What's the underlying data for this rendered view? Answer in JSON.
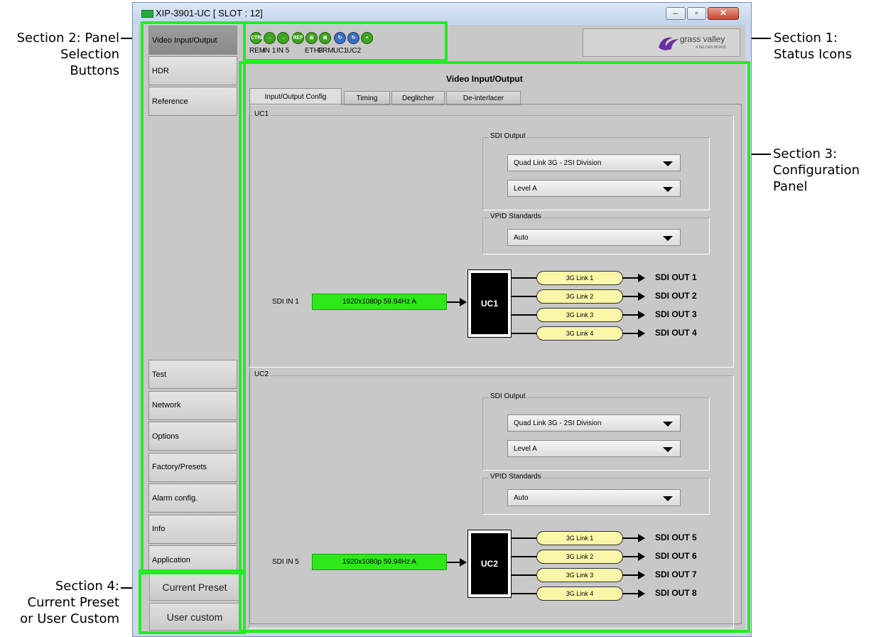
{
  "callouts": {
    "section1": "Section 1:\nStatus Icons",
    "section2": "Section 2: Panel\nSelection\nButtons",
    "section3": "Section 3:\nConfiguration\nPanel",
    "section4": "Section 4:\nCurrent Preset\nor User Custom"
  },
  "window": {
    "title": "XIP-3901-UC [ SLOT : 12]",
    "minimize_icon": "minimize-icon",
    "maximize_icon": "maximize-icon",
    "close_icon": "close-icon"
  },
  "sidebar": {
    "top_items": [
      {
        "label": "Video Input/Output",
        "active": true
      },
      {
        "label": "HDR"
      },
      {
        "label": "Reference"
      }
    ],
    "bottom_items": [
      {
        "label": "Test"
      },
      {
        "label": "Network"
      },
      {
        "label": "Options"
      },
      {
        "label": "Factory/Presets"
      },
      {
        "label": "Alarm config."
      },
      {
        "label": "Info"
      },
      {
        "label": "Application"
      }
    ]
  },
  "preset": {
    "current_preset_label": "Current Preset",
    "user_custom_label": "User custom"
  },
  "status_icons": [
    {
      "icon": "ctrl-icon",
      "glyph": "CTRL",
      "label": "REM"
    },
    {
      "icon": "arrow-right-icon",
      "glyph": "→",
      "label": "IN 1"
    },
    {
      "icon": "arrow-right-icon",
      "glyph": "→",
      "label": "IN 5"
    },
    {
      "icon": "ref-icon",
      "glyph": "REF",
      "label": ""
    },
    {
      "icon": "network-icon",
      "glyph": "⊞",
      "label": "ETH3"
    },
    {
      "icon": "network-icon",
      "glyph": "⊞",
      "label": "FRM"
    },
    {
      "icon": "uc-icon",
      "glyph": "↻",
      "label": "UC1"
    },
    {
      "icon": "uc-icon",
      "glyph": "↻",
      "label": "UC2"
    },
    {
      "icon": "plus-icon",
      "glyph": "+",
      "label": ""
    }
  ],
  "logo": {
    "text": "grass valley",
    "subtext": "A BELDEN BRAND"
  },
  "panel": {
    "title": "Video Input/Output",
    "tabs": [
      {
        "label": "Input/Output Config",
        "active": true
      },
      {
        "label": "Timing"
      },
      {
        "label": "Deglitcher"
      },
      {
        "label": "De-interlacer"
      }
    ],
    "uc1": {
      "group_label": "UC1",
      "sdi_output_label": "SDI Output",
      "sdi_output_value": "Quad Link 3G - 2SI Division",
      "level_value": "Level A",
      "vpid_label": "VPID Standards",
      "vpid_value": "Auto",
      "input_label": "SDI IN 1",
      "input_format": "1920x1080p 59.94Hz A",
      "block_label": "UC1",
      "links": [
        "3G Link 1",
        "3G Link 2",
        "3G Link 3",
        "3G Link 4"
      ],
      "outputs": [
        "SDI OUT 1",
        "SDI OUT 2",
        "SDI OUT 3",
        "SDI OUT 4"
      ]
    },
    "uc2": {
      "group_label": "UC2",
      "sdi_output_label": "SDI Output",
      "sdi_output_value": "Quad Link 3G - 2SI Division",
      "level_value": "Level A",
      "vpid_label": "VPID Standards",
      "vpid_value": "Auto",
      "input_label": "SDI IN 5",
      "input_format": "1920x1080p 59.94Hz A",
      "block_label": "UC2",
      "links": [
        "3G Link 1",
        "3G Link 2",
        "3G Link 3",
        "3G Link 4"
      ],
      "outputs": [
        "SDI OUT 5",
        "SDI OUT 6",
        "SDI OUT 7",
        "SDI OUT 8"
      ]
    }
  },
  "colors": {
    "highlight": "#20ee20",
    "format_box": "#2ee81a",
    "link_pill": "#faf7a8"
  }
}
